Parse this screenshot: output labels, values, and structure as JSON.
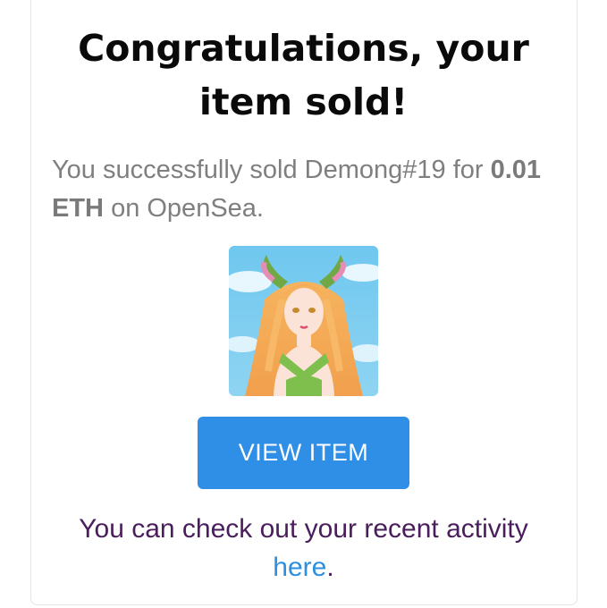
{
  "heading": {
    "line1": "Congratulations, your",
    "line2": "item sold!"
  },
  "message": {
    "prefix": "You successfully sold Demong#19 for",
    "price": "0.01 ETH",
    "suffix": "on OpenSea."
  },
  "item_image": {
    "alt": "Demong#19"
  },
  "view_button": {
    "label": "VIEW ITEM"
  },
  "footer": {
    "text": "You can check out your recent activity",
    "link_label": "here",
    "end": "."
  },
  "colors": {
    "button": "#2f8ee5",
    "link": "#2d8fe0",
    "footer_text": "#4a1d5c",
    "muted_text": "#7f7f7f"
  }
}
